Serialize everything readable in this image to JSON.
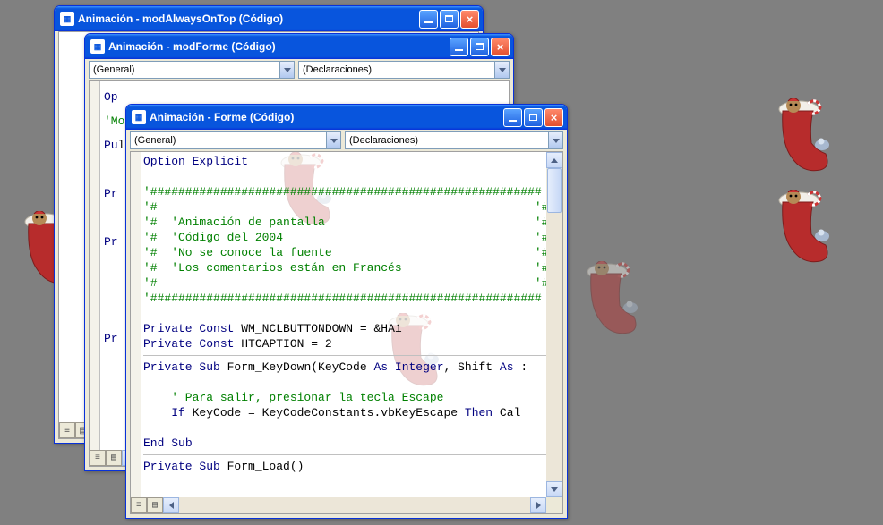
{
  "windows": {
    "w1": {
      "title": "Animación - modAlwaysOnTop (Código)"
    },
    "w2": {
      "title": "Animación - modForme (Código)"
    },
    "w3": {
      "title": "Animación - Forme (Código)"
    }
  },
  "combos": {
    "left": "(General)",
    "right": "(Declaraciones)"
  },
  "peek": {
    "l1": "Op",
    "l2": "'Mo",
    "l3": "Pul",
    "l4": "Pr",
    "l5": "Pr",
    "l6": "Pr"
  },
  "code": {
    "line1": "Option Explicit",
    "line2": "'########################################################",
    "line3": "'#                                                      '#",
    "line4": "'#  'Animación de pantalla                              '#",
    "line5": "'#  'Código del 2004                                    '#",
    "line6": "'#  'No se conoce la fuente                             '#",
    "line7": "'#  'Los comentarios están en Francés                   '#",
    "line8": "'#                                                      '#",
    "line9": "'########################################################",
    "kw_private": "Private",
    "kw_const": "Const",
    "kw_sub": "Sub",
    "kw_as": "As",
    "kw_integer": "Integer",
    "kw_if": "If",
    "kw_then": "Then",
    "kw_end": "End",
    "c1_name": " WM_NCLBUTTONDOWN = &HA1",
    "c2_name": " HTCAPTION = 2",
    "sub1_name": " Form_KeyDown(KeyCode ",
    "sub1_mid": ", Shift ",
    "cm_para": "    ' Para salir, presionar la tecla Escape",
    "if_body": " KeyCode = KeyCodeConstants.vbKeyEscape ",
    "if_tail": " Cal",
    "sub2_name": " Form_Load()"
  }
}
